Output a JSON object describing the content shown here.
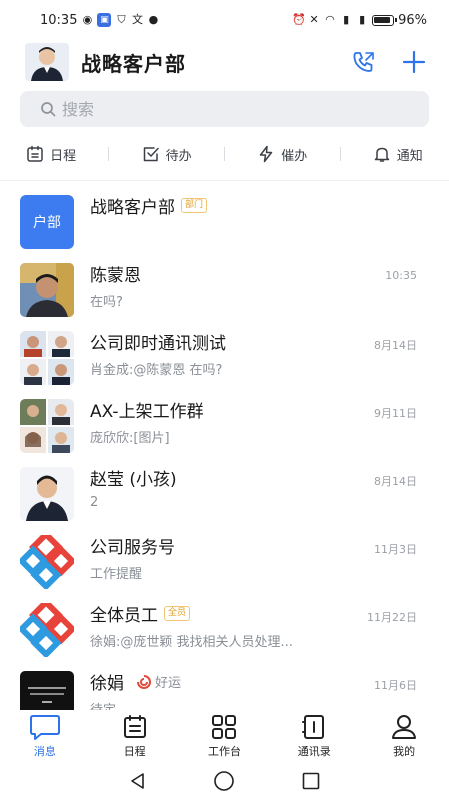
{
  "status_bar": {
    "time": "10:35",
    "battery": "96%"
  },
  "header": {
    "title": "战略客户部"
  },
  "search": {
    "placeholder": "搜索"
  },
  "quick_actions": [
    {
      "label": "日程",
      "icon": "calendar-icon"
    },
    {
      "label": "待办",
      "icon": "checkbox-icon"
    },
    {
      "label": "催办",
      "icon": "lightning-icon"
    },
    {
      "label": "通知",
      "icon": "bell-icon"
    }
  ],
  "chats": [
    {
      "name": "战略客户部",
      "tag": "部门",
      "preview": "",
      "time": "",
      "avatar_text": "户部"
    },
    {
      "name": "陈蒙恩",
      "preview": "在吗?",
      "time": "10:35"
    },
    {
      "name": "公司即时通讯测试",
      "preview": "肖金成:@陈蒙恩 在吗?",
      "time": "8月14日"
    },
    {
      "name": "AX-上架工作群",
      "preview": "庞欣欣:[图片]",
      "time": "9月11日"
    },
    {
      "name": "赵莹 (小孩)",
      "preview": "2",
      "time": "8月14日"
    },
    {
      "name": "公司服务号",
      "preview": "工作提醒",
      "time": "11月3日"
    },
    {
      "name": "全体员工",
      "tag": "全员",
      "preview": "徐娟:@庞世颖 我找相关人员处理...",
      "time": "11月22日"
    },
    {
      "name": "徐娟",
      "status": "好运",
      "preview": "待定",
      "time": "11月6日"
    }
  ],
  "bottom_nav": [
    {
      "label": "消息",
      "active": true
    },
    {
      "label": "日程"
    },
    {
      "label": "工作台"
    },
    {
      "label": "通讯录"
    },
    {
      "label": "我的"
    }
  ],
  "colors": {
    "accent": "#2e74e8",
    "tag": "#e0a12c",
    "dept_avatar": "#3d7cf0"
  }
}
